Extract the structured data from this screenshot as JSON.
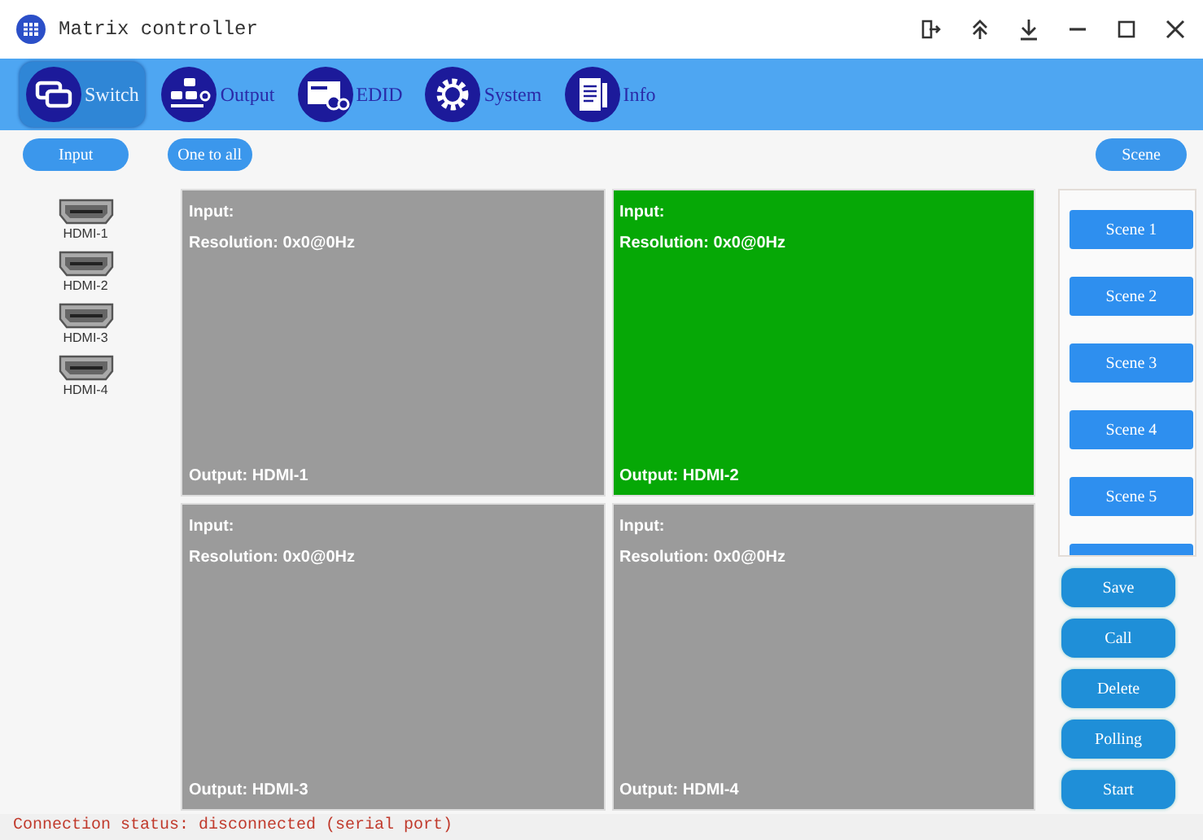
{
  "window": {
    "title": "Matrix controller"
  },
  "tabs": [
    {
      "label": "Switch",
      "selected": true
    },
    {
      "label": "Output",
      "selected": false
    },
    {
      "label": "EDID",
      "selected": false
    },
    {
      "label": "System",
      "selected": false
    },
    {
      "label": "Info",
      "selected": false
    }
  ],
  "toolbar": {
    "input_button": "Input",
    "one_to_all_button": "One to all",
    "scene_button": "Scene"
  },
  "inputs": [
    "HDMI-1",
    "HDMI-2",
    "HDMI-3",
    "HDMI-4"
  ],
  "outputs": [
    {
      "input": "Input:",
      "resolution": "Resolution: 0x0@0Hz",
      "output": "Output: HDMI-1",
      "selected": false
    },
    {
      "input": "Input:",
      "resolution": "Resolution: 0x0@0Hz",
      "output": "Output: HDMI-2",
      "selected": true
    },
    {
      "input": "Input:",
      "resolution": "Resolution: 0x0@0Hz",
      "output": "Output: HDMI-3",
      "selected": false
    },
    {
      "input": "Input:",
      "resolution": "Resolution: 0x0@0Hz",
      "output": "Output: HDMI-4",
      "selected": false
    }
  ],
  "scenes": [
    "Scene 1",
    "Scene 2",
    "Scene 3",
    "Scene 4",
    "Scene 5"
  ],
  "scene_actions": [
    "Save",
    "Call",
    "Delete",
    "Polling",
    "Start"
  ],
  "status_bar": "Connection status: disconnected (serial port)"
}
